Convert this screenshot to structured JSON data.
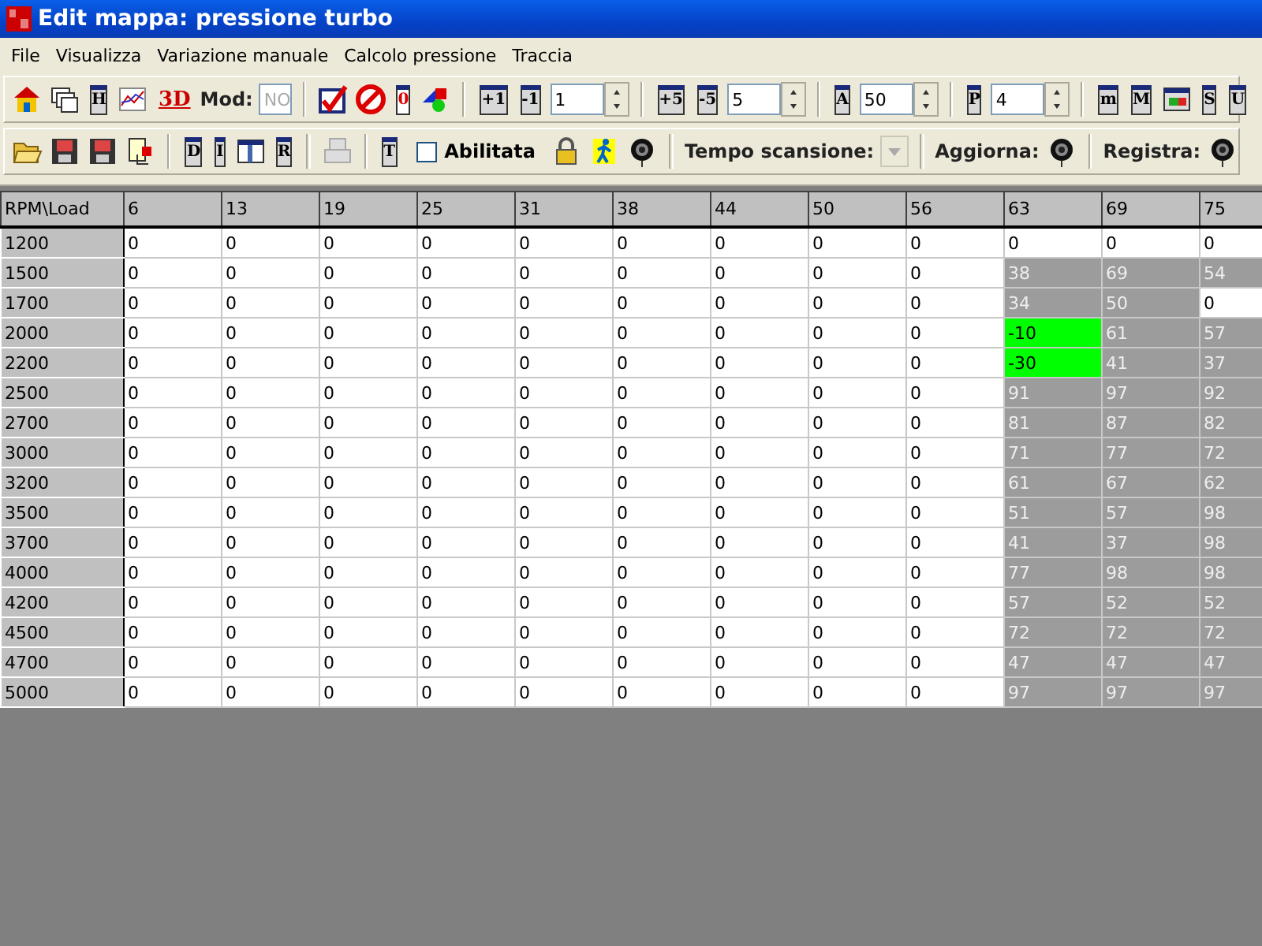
{
  "window": {
    "title": "Edit mappa: pressione turbo"
  },
  "menu": [
    "File",
    "Visualizza",
    "Variazione manuale",
    "Calcolo pressione",
    "Traccia"
  ],
  "toolbars": [
    [
      {
        "kind": "home"
      },
      {
        "kind": "windows"
      },
      {
        "kind": "glyph",
        "text": "H"
      },
      {
        "kind": "graph"
      },
      {
        "kind": "big",
        "text": "3D"
      },
      {
        "kind": "label",
        "text": "Mod:"
      },
      {
        "kind": "field",
        "placeholder": "NO"
      },
      {
        "kind": "sep"
      },
      {
        "kind": "check"
      },
      {
        "kind": "forbid"
      },
      {
        "kind": "redglyph",
        "text": "0"
      },
      {
        "kind": "shapes"
      },
      {
        "kind": "sep"
      },
      {
        "kind": "glyph",
        "text": "+1"
      },
      {
        "kind": "glyph",
        "text": "-1"
      },
      {
        "kind": "spin",
        "value": "1"
      },
      {
        "kind": "sep"
      },
      {
        "kind": "glyph",
        "text": "+5"
      },
      {
        "kind": "glyph",
        "text": "-5"
      },
      {
        "kind": "spin",
        "value": "5"
      },
      {
        "kind": "sep"
      },
      {
        "kind": "glyph",
        "text": "A"
      },
      {
        "kind": "spin",
        "value": "50"
      },
      {
        "kind": "sep"
      },
      {
        "kind": "glyph",
        "text": "P"
      },
      {
        "kind": "spin",
        "value": "4"
      },
      {
        "kind": "sep"
      },
      {
        "kind": "glyph",
        "text": "m"
      },
      {
        "kind": "glyph",
        "text": "M"
      },
      {
        "kind": "colorbar"
      },
      {
        "kind": "glyph",
        "text": "S"
      },
      {
        "kind": "glyph",
        "text": "U"
      }
    ],
    [
      {
        "kind": "folder"
      },
      {
        "kind": "floppy"
      },
      {
        "kind": "floppy"
      },
      {
        "kind": "export"
      },
      {
        "kind": "sep"
      },
      {
        "kind": "glyph",
        "text": "D"
      },
      {
        "kind": "glyph",
        "text": "I"
      },
      {
        "kind": "window"
      },
      {
        "kind": "glyph",
        "text": "R"
      },
      {
        "kind": "sep"
      },
      {
        "kind": "printer"
      },
      {
        "kind": "sep"
      },
      {
        "kind": "glyph",
        "text": "T"
      },
      {
        "kind": "checkbox",
        "label": "Abilitata",
        "checked": false
      },
      {
        "kind": "lock"
      },
      {
        "kind": "runner"
      },
      {
        "kind": "knob"
      },
      {
        "kind": "sep"
      },
      {
        "kind": "label",
        "text": "Tempo scansione:"
      },
      {
        "kind": "combo"
      },
      {
        "kind": "sep"
      },
      {
        "kind": "label",
        "text": "Aggiorna:"
      },
      {
        "kind": "knob"
      },
      {
        "kind": "sep"
      },
      {
        "kind": "label",
        "text": "Registra:"
      },
      {
        "kind": "knob"
      }
    ]
  ],
  "table": {
    "corner": "RPM\\Load",
    "columns": [
      "6",
      "13",
      "19",
      "25",
      "31",
      "38",
      "44",
      "50",
      "56",
      "63",
      "69",
      "75"
    ],
    "rows": [
      {
        "rpm": "1200",
        "cells": [
          {
            "value": "0",
            "color": "#ffffff"
          },
          {
            "value": "0",
            "color": "#ffffff"
          },
          {
            "value": "0",
            "color": "#ffffff"
          },
          {
            "value": "0",
            "color": "#ffffff"
          },
          {
            "value": "0",
            "color": "#ffffff"
          },
          {
            "value": "0",
            "color": "#ffffff"
          },
          {
            "value": "0",
            "color": "#ffffff"
          },
          {
            "value": "0",
            "color": "#ffffff"
          },
          {
            "value": "0",
            "color": "#ffffff"
          },
          {
            "value": "0",
            "color": "#ffffff"
          },
          {
            "value": "0",
            "color": "#ffffff"
          },
          {
            "value": "0",
            "color": "#ffffff"
          }
        ]
      },
      {
        "rpm": "1500",
        "cells": [
          {
            "value": "0",
            "color": "#ffffff"
          },
          {
            "value": "0",
            "color": "#ffffff"
          },
          {
            "value": "0",
            "color": "#ffffff"
          },
          {
            "value": "0",
            "color": "#ffffff"
          },
          {
            "value": "0",
            "color": "#ffffff"
          },
          {
            "value": "0",
            "color": "#ffffff"
          },
          {
            "value": "0",
            "color": "#ffffff"
          },
          {
            "value": "0",
            "color": "#ffffff"
          },
          {
            "value": "0",
            "color": "#ffffff"
          },
          {
            "value": "38",
            "color": "#9c9c9c"
          },
          {
            "value": "69",
            "color": "#9c9c9c"
          },
          {
            "value": "54",
            "color": "#9c9c9c"
          }
        ]
      },
      {
        "rpm": "1700",
        "cells": [
          {
            "value": "0",
            "color": "#ffffff"
          },
          {
            "value": "0",
            "color": "#ffffff"
          },
          {
            "value": "0",
            "color": "#ffffff"
          },
          {
            "value": "0",
            "color": "#ffffff"
          },
          {
            "value": "0",
            "color": "#ffffff"
          },
          {
            "value": "0",
            "color": "#ffffff"
          },
          {
            "value": "0",
            "color": "#ffffff"
          },
          {
            "value": "0",
            "color": "#ffffff"
          },
          {
            "value": "0",
            "color": "#ffffff"
          },
          {
            "value": "34",
            "color": "#9c9c9c"
          },
          {
            "value": "50",
            "color": "#9c9c9c"
          },
          {
            "value": "0",
            "color": "#ffffff"
          }
        ]
      },
      {
        "rpm": "2000",
        "cells": [
          {
            "value": "0",
            "color": "#ffffff"
          },
          {
            "value": "0",
            "color": "#ffffff"
          },
          {
            "value": "0",
            "color": "#ffffff"
          },
          {
            "value": "0",
            "color": "#ffffff"
          },
          {
            "value": "0",
            "color": "#ffffff"
          },
          {
            "value": "0",
            "color": "#ffffff"
          },
          {
            "value": "0",
            "color": "#ffffff"
          },
          {
            "value": "0",
            "color": "#ffffff"
          },
          {
            "value": "0",
            "color": "#ffffff"
          },
          {
            "value": "-10",
            "color": "#00ff00"
          },
          {
            "value": "61",
            "color": "#9c9c9c"
          },
          {
            "value": "57",
            "color": "#9c9c9c"
          }
        ]
      },
      {
        "rpm": "2200",
        "cells": [
          {
            "value": "0",
            "color": "#ffffff"
          },
          {
            "value": "0",
            "color": "#ffffff"
          },
          {
            "value": "0",
            "color": "#ffffff"
          },
          {
            "value": "0",
            "color": "#ffffff"
          },
          {
            "value": "0",
            "color": "#ffffff"
          },
          {
            "value": "0",
            "color": "#ffffff"
          },
          {
            "value": "0",
            "color": "#ffffff"
          },
          {
            "value": "0",
            "color": "#ffffff"
          },
          {
            "value": "0",
            "color": "#ffffff"
          },
          {
            "value": "-30",
            "color": "#00ff00"
          },
          {
            "value": "41",
            "color": "#9c9c9c"
          },
          {
            "value": "37",
            "color": "#9c9c9c"
          }
        ]
      },
      {
        "rpm": "2500",
        "cells": [
          {
            "value": "0",
            "color": "#ffffff"
          },
          {
            "value": "0",
            "color": "#ffffff"
          },
          {
            "value": "0",
            "color": "#ffffff"
          },
          {
            "value": "0",
            "color": "#ffffff"
          },
          {
            "value": "0",
            "color": "#ffffff"
          },
          {
            "value": "0",
            "color": "#ffffff"
          },
          {
            "value": "0",
            "color": "#ffffff"
          },
          {
            "value": "0",
            "color": "#ffffff"
          },
          {
            "value": "0",
            "color": "#ffffff"
          },
          {
            "value": "91",
            "color": "#9c9c9c"
          },
          {
            "value": "97",
            "color": "#9c9c9c"
          },
          {
            "value": "92",
            "color": "#9c9c9c"
          }
        ]
      },
      {
        "rpm": "2700",
        "cells": [
          {
            "value": "0",
            "color": "#ffffff"
          },
          {
            "value": "0",
            "color": "#ffffff"
          },
          {
            "value": "0",
            "color": "#ffffff"
          },
          {
            "value": "0",
            "color": "#ffffff"
          },
          {
            "value": "0",
            "color": "#ffffff"
          },
          {
            "value": "0",
            "color": "#ffffff"
          },
          {
            "value": "0",
            "color": "#ffffff"
          },
          {
            "value": "0",
            "color": "#ffffff"
          },
          {
            "value": "0",
            "color": "#ffffff"
          },
          {
            "value": "81",
            "color": "#9c9c9c"
          },
          {
            "value": "87",
            "color": "#9c9c9c"
          },
          {
            "value": "82",
            "color": "#9c9c9c"
          }
        ]
      },
      {
        "rpm": "3000",
        "cells": [
          {
            "value": "0",
            "color": "#ffffff"
          },
          {
            "value": "0",
            "color": "#ffffff"
          },
          {
            "value": "0",
            "color": "#ffffff"
          },
          {
            "value": "0",
            "color": "#ffffff"
          },
          {
            "value": "0",
            "color": "#ffffff"
          },
          {
            "value": "0",
            "color": "#ffffff"
          },
          {
            "value": "0",
            "color": "#ffffff"
          },
          {
            "value": "0",
            "color": "#ffffff"
          },
          {
            "value": "0",
            "color": "#ffffff"
          },
          {
            "value": "71",
            "color": "#9c9c9c"
          },
          {
            "value": "77",
            "color": "#9c9c9c"
          },
          {
            "value": "72",
            "color": "#9c9c9c"
          }
        ]
      },
      {
        "rpm": "3200",
        "cells": [
          {
            "value": "0",
            "color": "#ffffff"
          },
          {
            "value": "0",
            "color": "#ffffff"
          },
          {
            "value": "0",
            "color": "#ffffff"
          },
          {
            "value": "0",
            "color": "#ffffff"
          },
          {
            "value": "0",
            "color": "#ffffff"
          },
          {
            "value": "0",
            "color": "#ffffff"
          },
          {
            "value": "0",
            "color": "#ffffff"
          },
          {
            "value": "0",
            "color": "#ffffff"
          },
          {
            "value": "0",
            "color": "#ffffff"
          },
          {
            "value": "61",
            "color": "#9c9c9c"
          },
          {
            "value": "67",
            "color": "#9c9c9c"
          },
          {
            "value": "62",
            "color": "#9c9c9c"
          }
        ]
      },
      {
        "rpm": "3500",
        "cells": [
          {
            "value": "0",
            "color": "#ffffff"
          },
          {
            "value": "0",
            "color": "#ffffff"
          },
          {
            "value": "0",
            "color": "#ffffff"
          },
          {
            "value": "0",
            "color": "#ffffff"
          },
          {
            "value": "0",
            "color": "#ffffff"
          },
          {
            "value": "0",
            "color": "#ffffff"
          },
          {
            "value": "0",
            "color": "#ffffff"
          },
          {
            "value": "0",
            "color": "#ffffff"
          },
          {
            "value": "0",
            "color": "#ffffff"
          },
          {
            "value": "51",
            "color": "#9c9c9c"
          },
          {
            "value": "57",
            "color": "#9c9c9c"
          },
          {
            "value": "98",
            "color": "#9c9c9c"
          }
        ]
      },
      {
        "rpm": "3700",
        "cells": [
          {
            "value": "0",
            "color": "#ffffff"
          },
          {
            "value": "0",
            "color": "#ffffff"
          },
          {
            "value": "0",
            "color": "#ffffff"
          },
          {
            "value": "0",
            "color": "#ffffff"
          },
          {
            "value": "0",
            "color": "#ffffff"
          },
          {
            "value": "0",
            "color": "#ffffff"
          },
          {
            "value": "0",
            "color": "#ffffff"
          },
          {
            "value": "0",
            "color": "#ffffff"
          },
          {
            "value": "0",
            "color": "#ffffff"
          },
          {
            "value": "41",
            "color": "#9c9c9c"
          },
          {
            "value": "37",
            "color": "#9c9c9c"
          },
          {
            "value": "98",
            "color": "#9c9c9c"
          }
        ]
      },
      {
        "rpm": "4000",
        "cells": [
          {
            "value": "0",
            "color": "#ffffff"
          },
          {
            "value": "0",
            "color": "#ffffff"
          },
          {
            "value": "0",
            "color": "#ffffff"
          },
          {
            "value": "0",
            "color": "#ffffff"
          },
          {
            "value": "0",
            "color": "#ffffff"
          },
          {
            "value": "0",
            "color": "#ffffff"
          },
          {
            "value": "0",
            "color": "#ffffff"
          },
          {
            "value": "0",
            "color": "#ffffff"
          },
          {
            "value": "0",
            "color": "#ffffff"
          },
          {
            "value": "77",
            "color": "#9c9c9c"
          },
          {
            "value": "98",
            "color": "#9c9c9c"
          },
          {
            "value": "98",
            "color": "#9c9c9c"
          }
        ]
      },
      {
        "rpm": "4200",
        "cells": [
          {
            "value": "0",
            "color": "#ffffff"
          },
          {
            "value": "0",
            "color": "#ffffff"
          },
          {
            "value": "0",
            "color": "#ffffff"
          },
          {
            "value": "0",
            "color": "#ffffff"
          },
          {
            "value": "0",
            "color": "#ffffff"
          },
          {
            "value": "0",
            "color": "#ffffff"
          },
          {
            "value": "0",
            "color": "#ffffff"
          },
          {
            "value": "0",
            "color": "#ffffff"
          },
          {
            "value": "0",
            "color": "#ffffff"
          },
          {
            "value": "57",
            "color": "#9c9c9c"
          },
          {
            "value": "52",
            "color": "#9c9c9c"
          },
          {
            "value": "52",
            "color": "#9c9c9c"
          }
        ]
      },
      {
        "rpm": "4500",
        "cells": [
          {
            "value": "0",
            "color": "#ffffff"
          },
          {
            "value": "0",
            "color": "#ffffff"
          },
          {
            "value": "0",
            "color": "#ffffff"
          },
          {
            "value": "0",
            "color": "#ffffff"
          },
          {
            "value": "0",
            "color": "#ffffff"
          },
          {
            "value": "0",
            "color": "#ffffff"
          },
          {
            "value": "0",
            "color": "#ffffff"
          },
          {
            "value": "0",
            "color": "#ffffff"
          },
          {
            "value": "0",
            "color": "#ffffff"
          },
          {
            "value": "72",
            "color": "#9c9c9c"
          },
          {
            "value": "72",
            "color": "#9c9c9c"
          },
          {
            "value": "72",
            "color": "#9c9c9c"
          }
        ]
      },
      {
        "rpm": "4700",
        "cells": [
          {
            "value": "0",
            "color": "#ffffff"
          },
          {
            "value": "0",
            "color": "#ffffff"
          },
          {
            "value": "0",
            "color": "#ffffff"
          },
          {
            "value": "0",
            "color": "#ffffff"
          },
          {
            "value": "0",
            "color": "#ffffff"
          },
          {
            "value": "0",
            "color": "#ffffff"
          },
          {
            "value": "0",
            "color": "#ffffff"
          },
          {
            "value": "0",
            "color": "#ffffff"
          },
          {
            "value": "0",
            "color": "#ffffff"
          },
          {
            "value": "47",
            "color": "#9c9c9c"
          },
          {
            "value": "47",
            "color": "#9c9c9c"
          },
          {
            "value": "47",
            "color": "#9c9c9c"
          }
        ]
      },
      {
        "rpm": "5000",
        "cells": [
          {
            "value": "0",
            "color": "#ffffff"
          },
          {
            "value": "0",
            "color": "#ffffff"
          },
          {
            "value": "0",
            "color": "#ffffff"
          },
          {
            "value": "0",
            "color": "#ffffff"
          },
          {
            "value": "0",
            "color": "#ffffff"
          },
          {
            "value": "0",
            "color": "#ffffff"
          },
          {
            "value": "0",
            "color": "#ffffff"
          },
          {
            "value": "0",
            "color": "#ffffff"
          },
          {
            "value": "0",
            "color": "#ffffff"
          },
          {
            "value": "97",
            "color": "#9c9c9c"
          },
          {
            "value": "97",
            "color": "#9c9c9c"
          },
          {
            "value": "97",
            "color": "#9c9c9c"
          }
        ]
      }
    ]
  }
}
